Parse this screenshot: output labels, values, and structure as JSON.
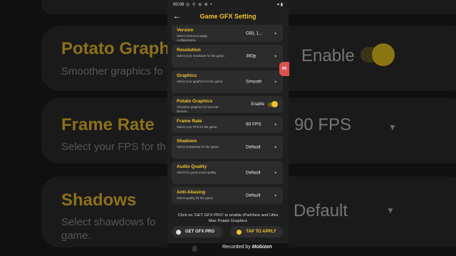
{
  "status": {
    "time": "00:09",
    "icons": "◎ ⚲ ⊚ ⊚ •",
    "right": "▾ ▮"
  },
  "appbar": {
    "title": "Game GFX Setting"
  },
  "settings": [
    {
      "title": "Version",
      "subtitle": "Select version to apply configurations",
      "value": "GBL 1...",
      "control": "dropdown"
    },
    {
      "title": "Resolution",
      "subtitle": "Select your resolution for the game.",
      "value": "360p",
      "control": "dropdown"
    },
    {
      "title": "Graphics",
      "subtitle": "Select your graphics for the game.",
      "value": "Smooth",
      "control": "dropdown"
    },
    {
      "title": "Potato Graphics",
      "subtitle": "Smoother graphics for low end devices.",
      "value": "Enable",
      "control": "toggle",
      "toggled": true
    },
    {
      "title": "Frame Rate",
      "subtitle": "Select your FPS for the game.",
      "value": "90 FPS",
      "control": "dropdown"
    },
    {
      "title": "Shadows",
      "subtitle": "Select shawdows for the game.",
      "value": "Default",
      "control": "dropdown"
    },
    {
      "title": "Audio Quality",
      "subtitle": "Select for good sound quality",
      "value": "Default",
      "control": "dropdown"
    },
    {
      "title": "Anti-Aliasing",
      "subtitle": "Select quality for the game",
      "value": "Default",
      "control": "dropdown"
    }
  ],
  "info": "Click on 'GET GFX PRO' to enable iPadView and Ultra Max Potato Graphics",
  "buttons": {
    "pro": "GET GFX PRO",
    "apply": "TAP TO APPLY"
  },
  "navbar": {
    "recents": "|||"
  },
  "recorder": {
    "prefix": "Recorded by",
    "brand": "Mobizen"
  },
  "background": {
    "potato_title": "Potato Graph",
    "potato_sub": "Smoother graphics fo",
    "potato_val": "Enable",
    "fps_title": "Frame Rate",
    "fps_sub": "Select your FPS for th",
    "fps_val": "90 FPS",
    "shadows_title": "Shadows",
    "shadows_sub": "Select shawdows fo",
    "shadows_sub2": "game.",
    "shadows_val": "Default"
  },
  "colors": {
    "accent": "#f2c230",
    "card": "#2c2c2c",
    "screen": "#1f1f1f"
  }
}
